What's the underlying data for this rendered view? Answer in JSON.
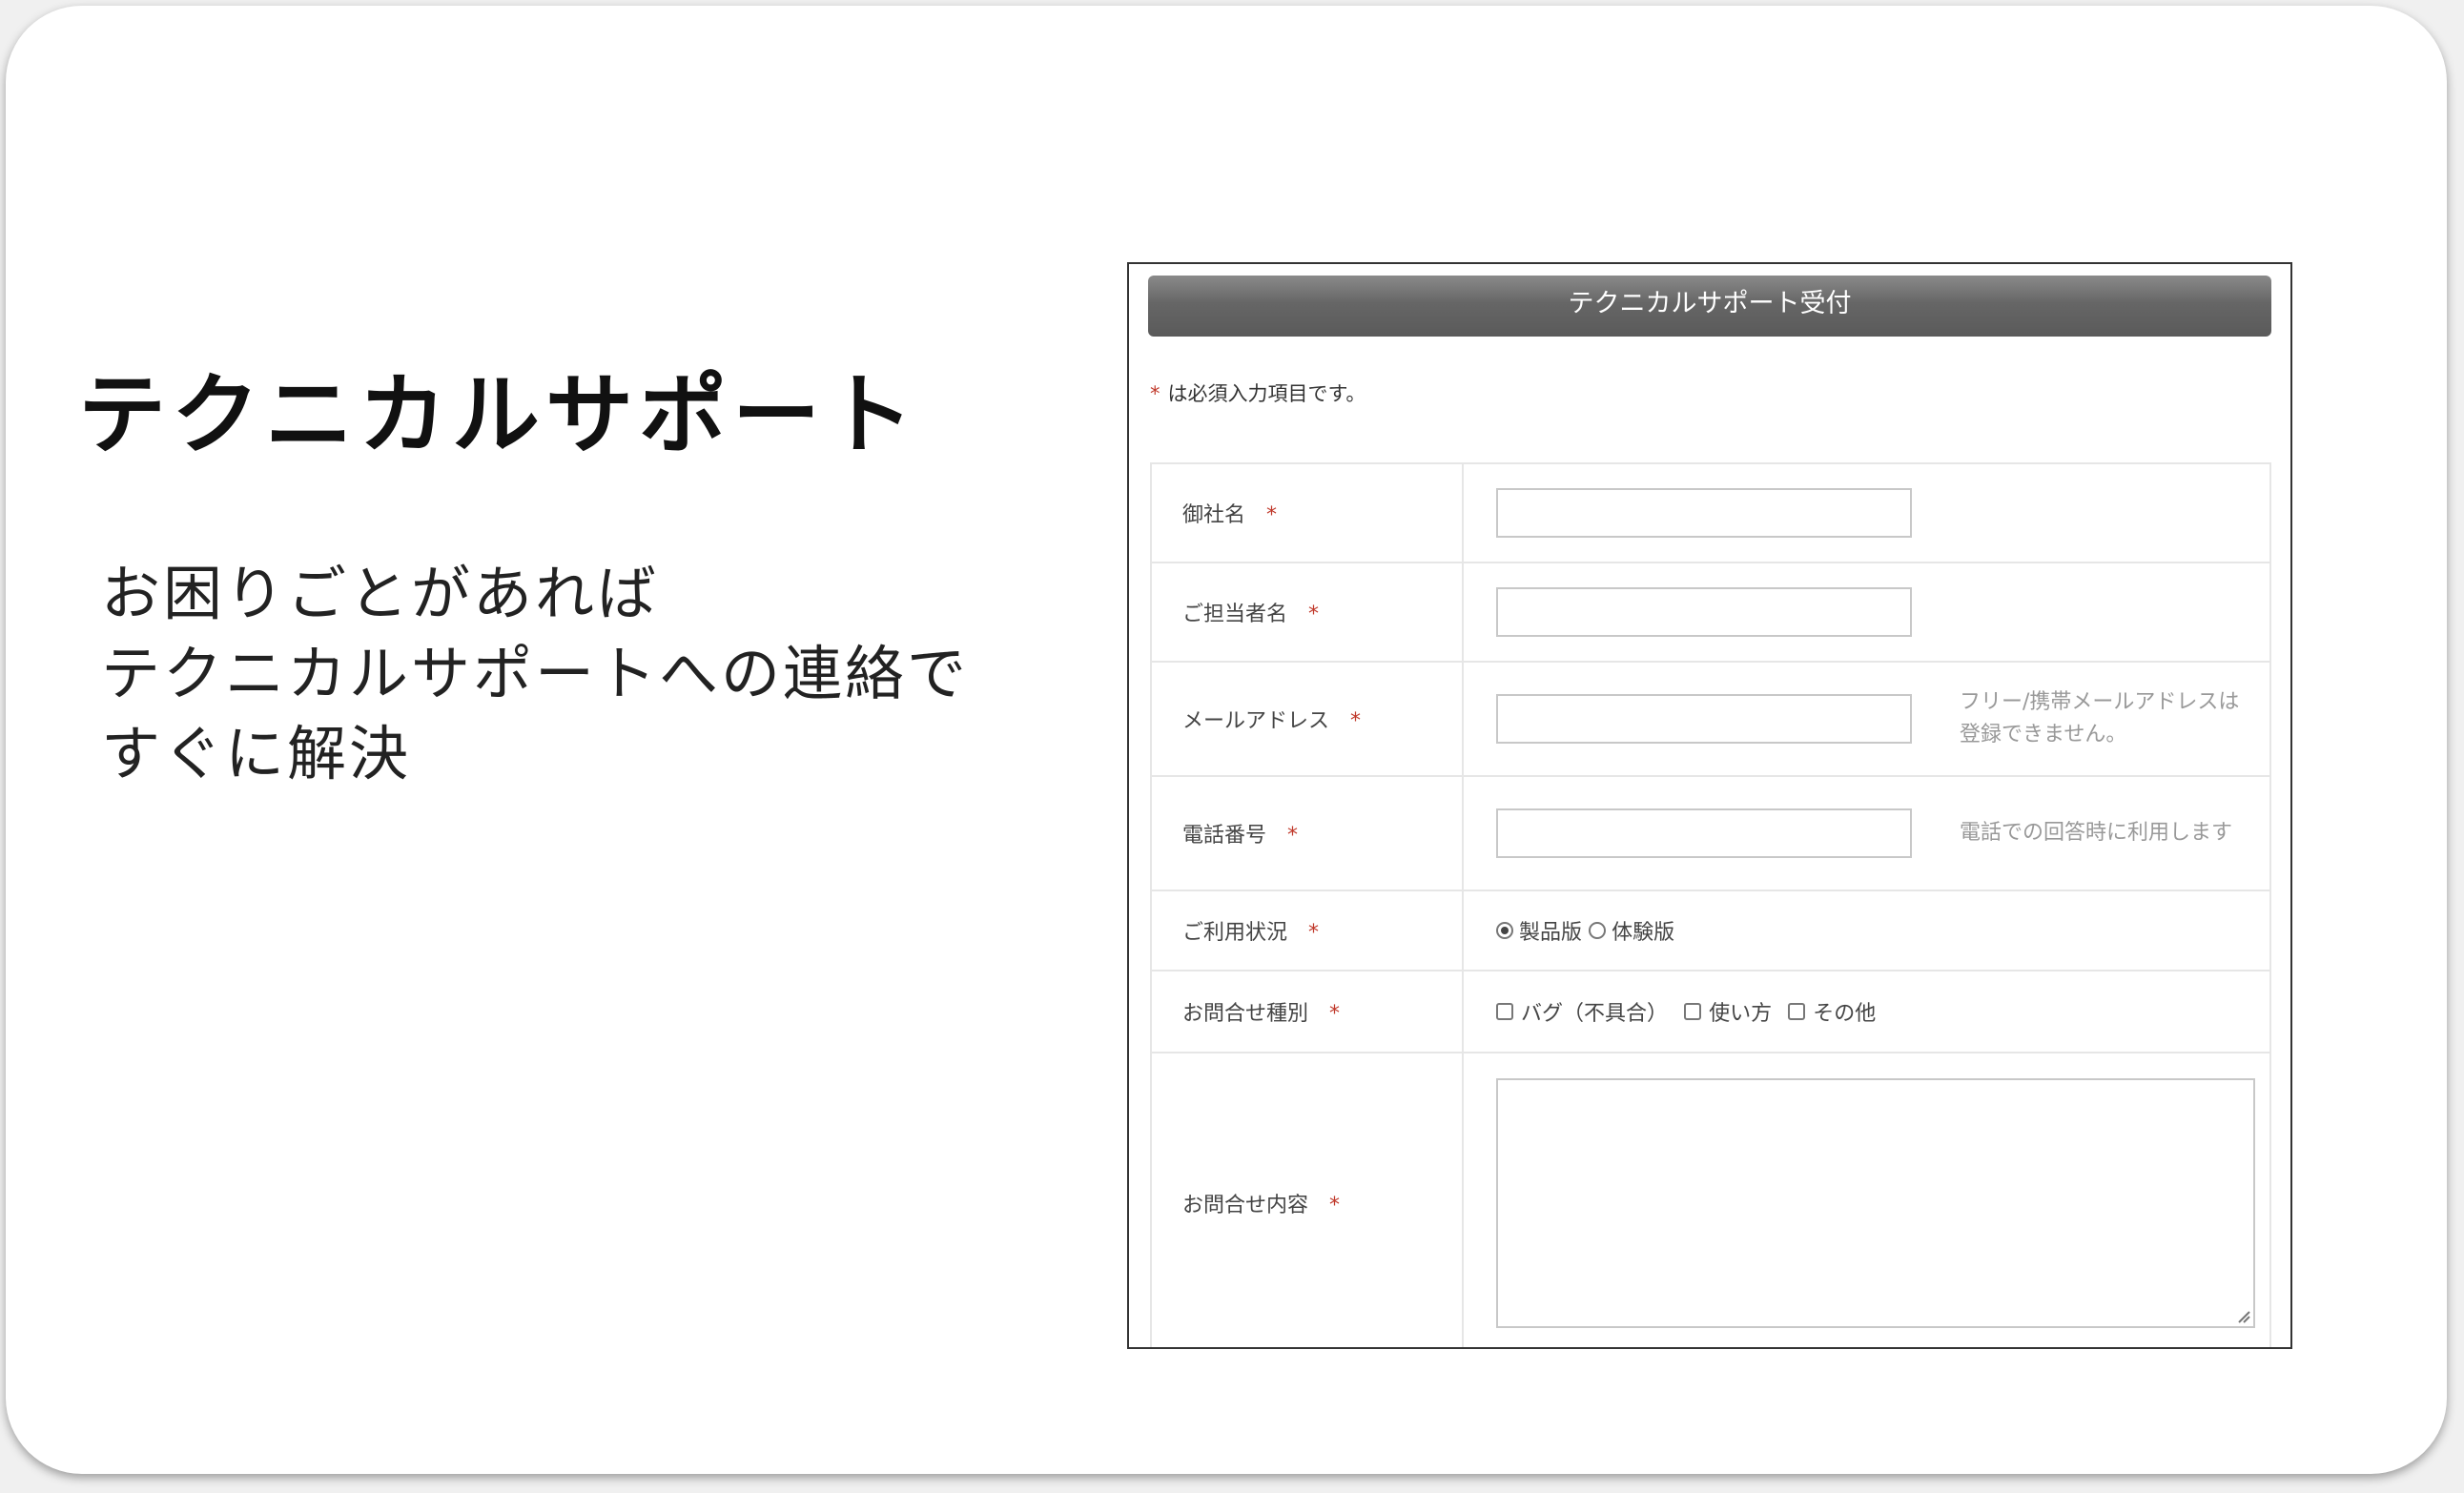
{
  "slide": {
    "title": "テクニカルサポート",
    "body_lines": [
      "お困りごとがあれば",
      "テクニカルサポートへの連絡で",
      "すぐに解決"
    ]
  },
  "form": {
    "header": "テクニカルサポート受付",
    "required_star": "*",
    "required_note": "は必須入力項目です。",
    "fields": {
      "company": {
        "label": "御社名",
        "value": ""
      },
      "person": {
        "label": "ご担当者名",
        "value": ""
      },
      "email": {
        "label": "メールアドレス",
        "value": "",
        "hint": "フリー/携帯メールアドレスは登録できません。"
      },
      "phone": {
        "label": "電話番号",
        "value": "",
        "hint": "電話での回答時に利用します"
      },
      "usage": {
        "label": "ご利用状況",
        "options": [
          "製品版",
          "体験版"
        ],
        "selected": "製品版"
      },
      "type": {
        "label": "お問合せ種別",
        "options": [
          "バグ（不具合）",
          "使い方",
          "その他"
        ]
      },
      "content": {
        "label": "お問合せ内容",
        "value": ""
      }
    }
  },
  "icons": {
    "resize": "resize-grip-icon"
  },
  "colors": {
    "required": "#c0392b",
    "header_bg": "#666666",
    "hint_text": "#999999"
  }
}
